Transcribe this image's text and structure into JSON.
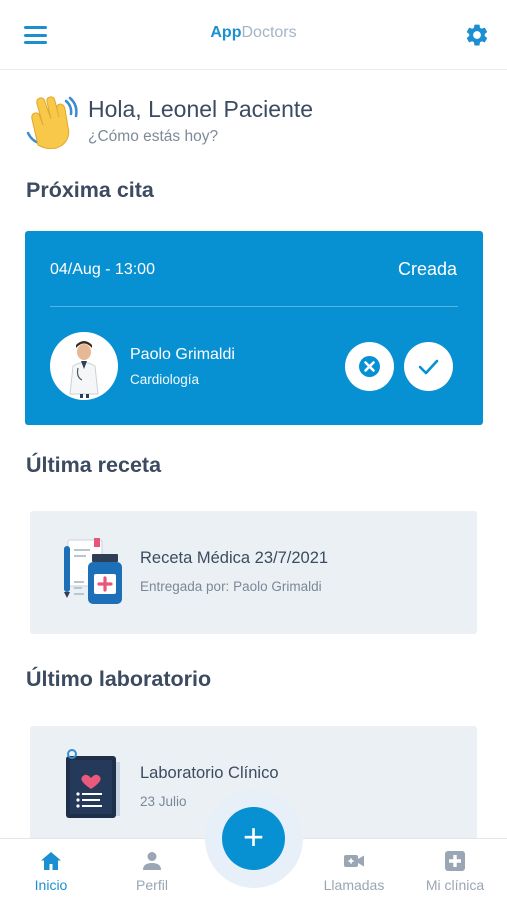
{
  "header": {
    "brand_primary": "App",
    "brand_secondary": "Doctors",
    "menu_icon": "hamburger-menu-icon",
    "settings_icon": "gear-icon",
    "accent_color": "#1b8fd1"
  },
  "greeting": {
    "title": "Hola, Leonel Paciente",
    "subtitle": "¿Cómo estás hoy?",
    "icon": "waving-hand-icon"
  },
  "next_appointment": {
    "section_title": "Próxima cita",
    "date": "04/Aug - 13:00",
    "status": "Creada",
    "doctor_name": "Paolo Grimaldi",
    "specialty": "Cardiología",
    "card_color": "#0891d2",
    "cancel_icon": "close-circle-icon",
    "confirm_icon": "check-icon"
  },
  "last_prescription": {
    "section_title": "Última receta",
    "title": "Receta Médica 23/7/2021",
    "subtitle": "Entregada por: Paolo Grimaldi",
    "icon": "prescription-icon"
  },
  "last_lab": {
    "section_title": "Último laboratorio",
    "title": "Laboratorio Clínico",
    "subtitle": "23 Julio",
    "icon": "clipboard-heart-icon"
  },
  "bottom_nav": {
    "items": [
      {
        "label": "Inicio",
        "icon": "home-icon",
        "active": true
      },
      {
        "label": "Perfil",
        "icon": "user-icon",
        "active": false
      },
      {
        "label": "Llamadas",
        "icon": "video-camera-icon",
        "active": false
      },
      {
        "label": "Mi clínica",
        "icon": "medical-cross-icon",
        "active": false
      }
    ],
    "fab_label": "+"
  }
}
